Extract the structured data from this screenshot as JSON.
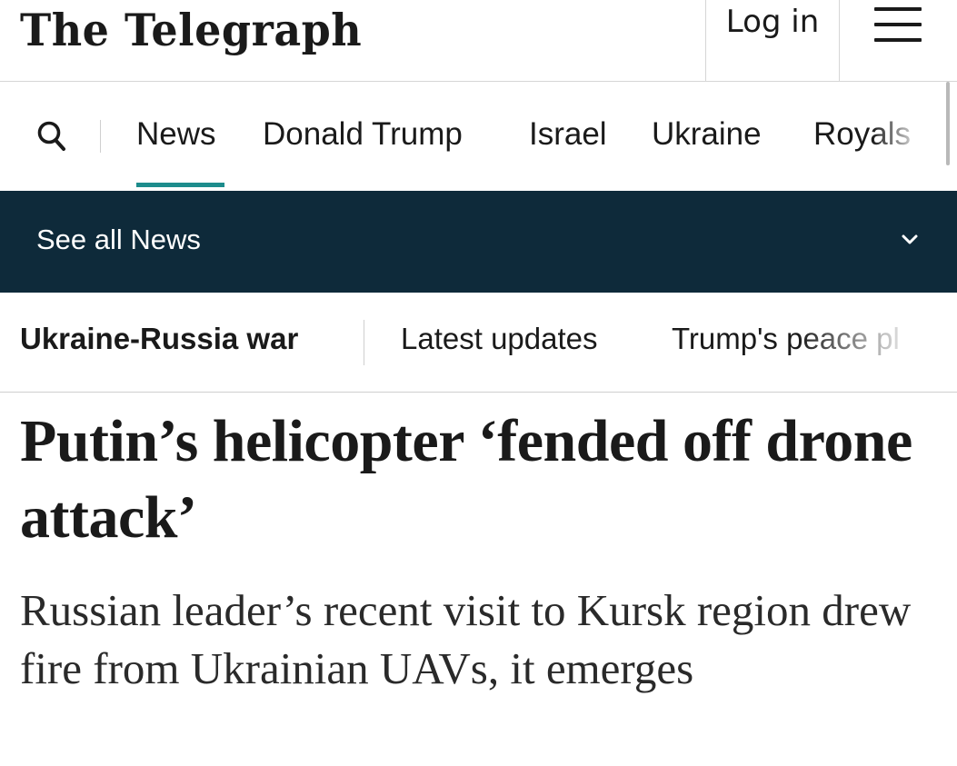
{
  "masthead": {
    "logo_text": "The Telegraph",
    "login_label": "Log in",
    "menu_icon": "hamburger-menu-icon"
  },
  "primary_nav": {
    "search_icon": "search-icon",
    "items": [
      {
        "label": "News",
        "active": true
      },
      {
        "label": "Donald Trump",
        "active": false
      },
      {
        "label": "Israel",
        "active": false
      },
      {
        "label": "Ukraine",
        "active": false
      },
      {
        "label": "Royals",
        "active": false
      }
    ],
    "accent_color": "#1d8c8c"
  },
  "see_all": {
    "label": "See all News",
    "icon": "chevron-down-icon",
    "background_color": "#0e2a3a"
  },
  "topic_nav": {
    "title": "Ukraine-Russia war",
    "links": [
      "Latest updates",
      "Trump's peace pl"
    ]
  },
  "article": {
    "headline": "Putin’s helicopter ‘fended off drone attack’",
    "standfirst": "Russian leader’s recent visit to Kursk region drew fire from Ukrainian UAVs, it emerges"
  }
}
